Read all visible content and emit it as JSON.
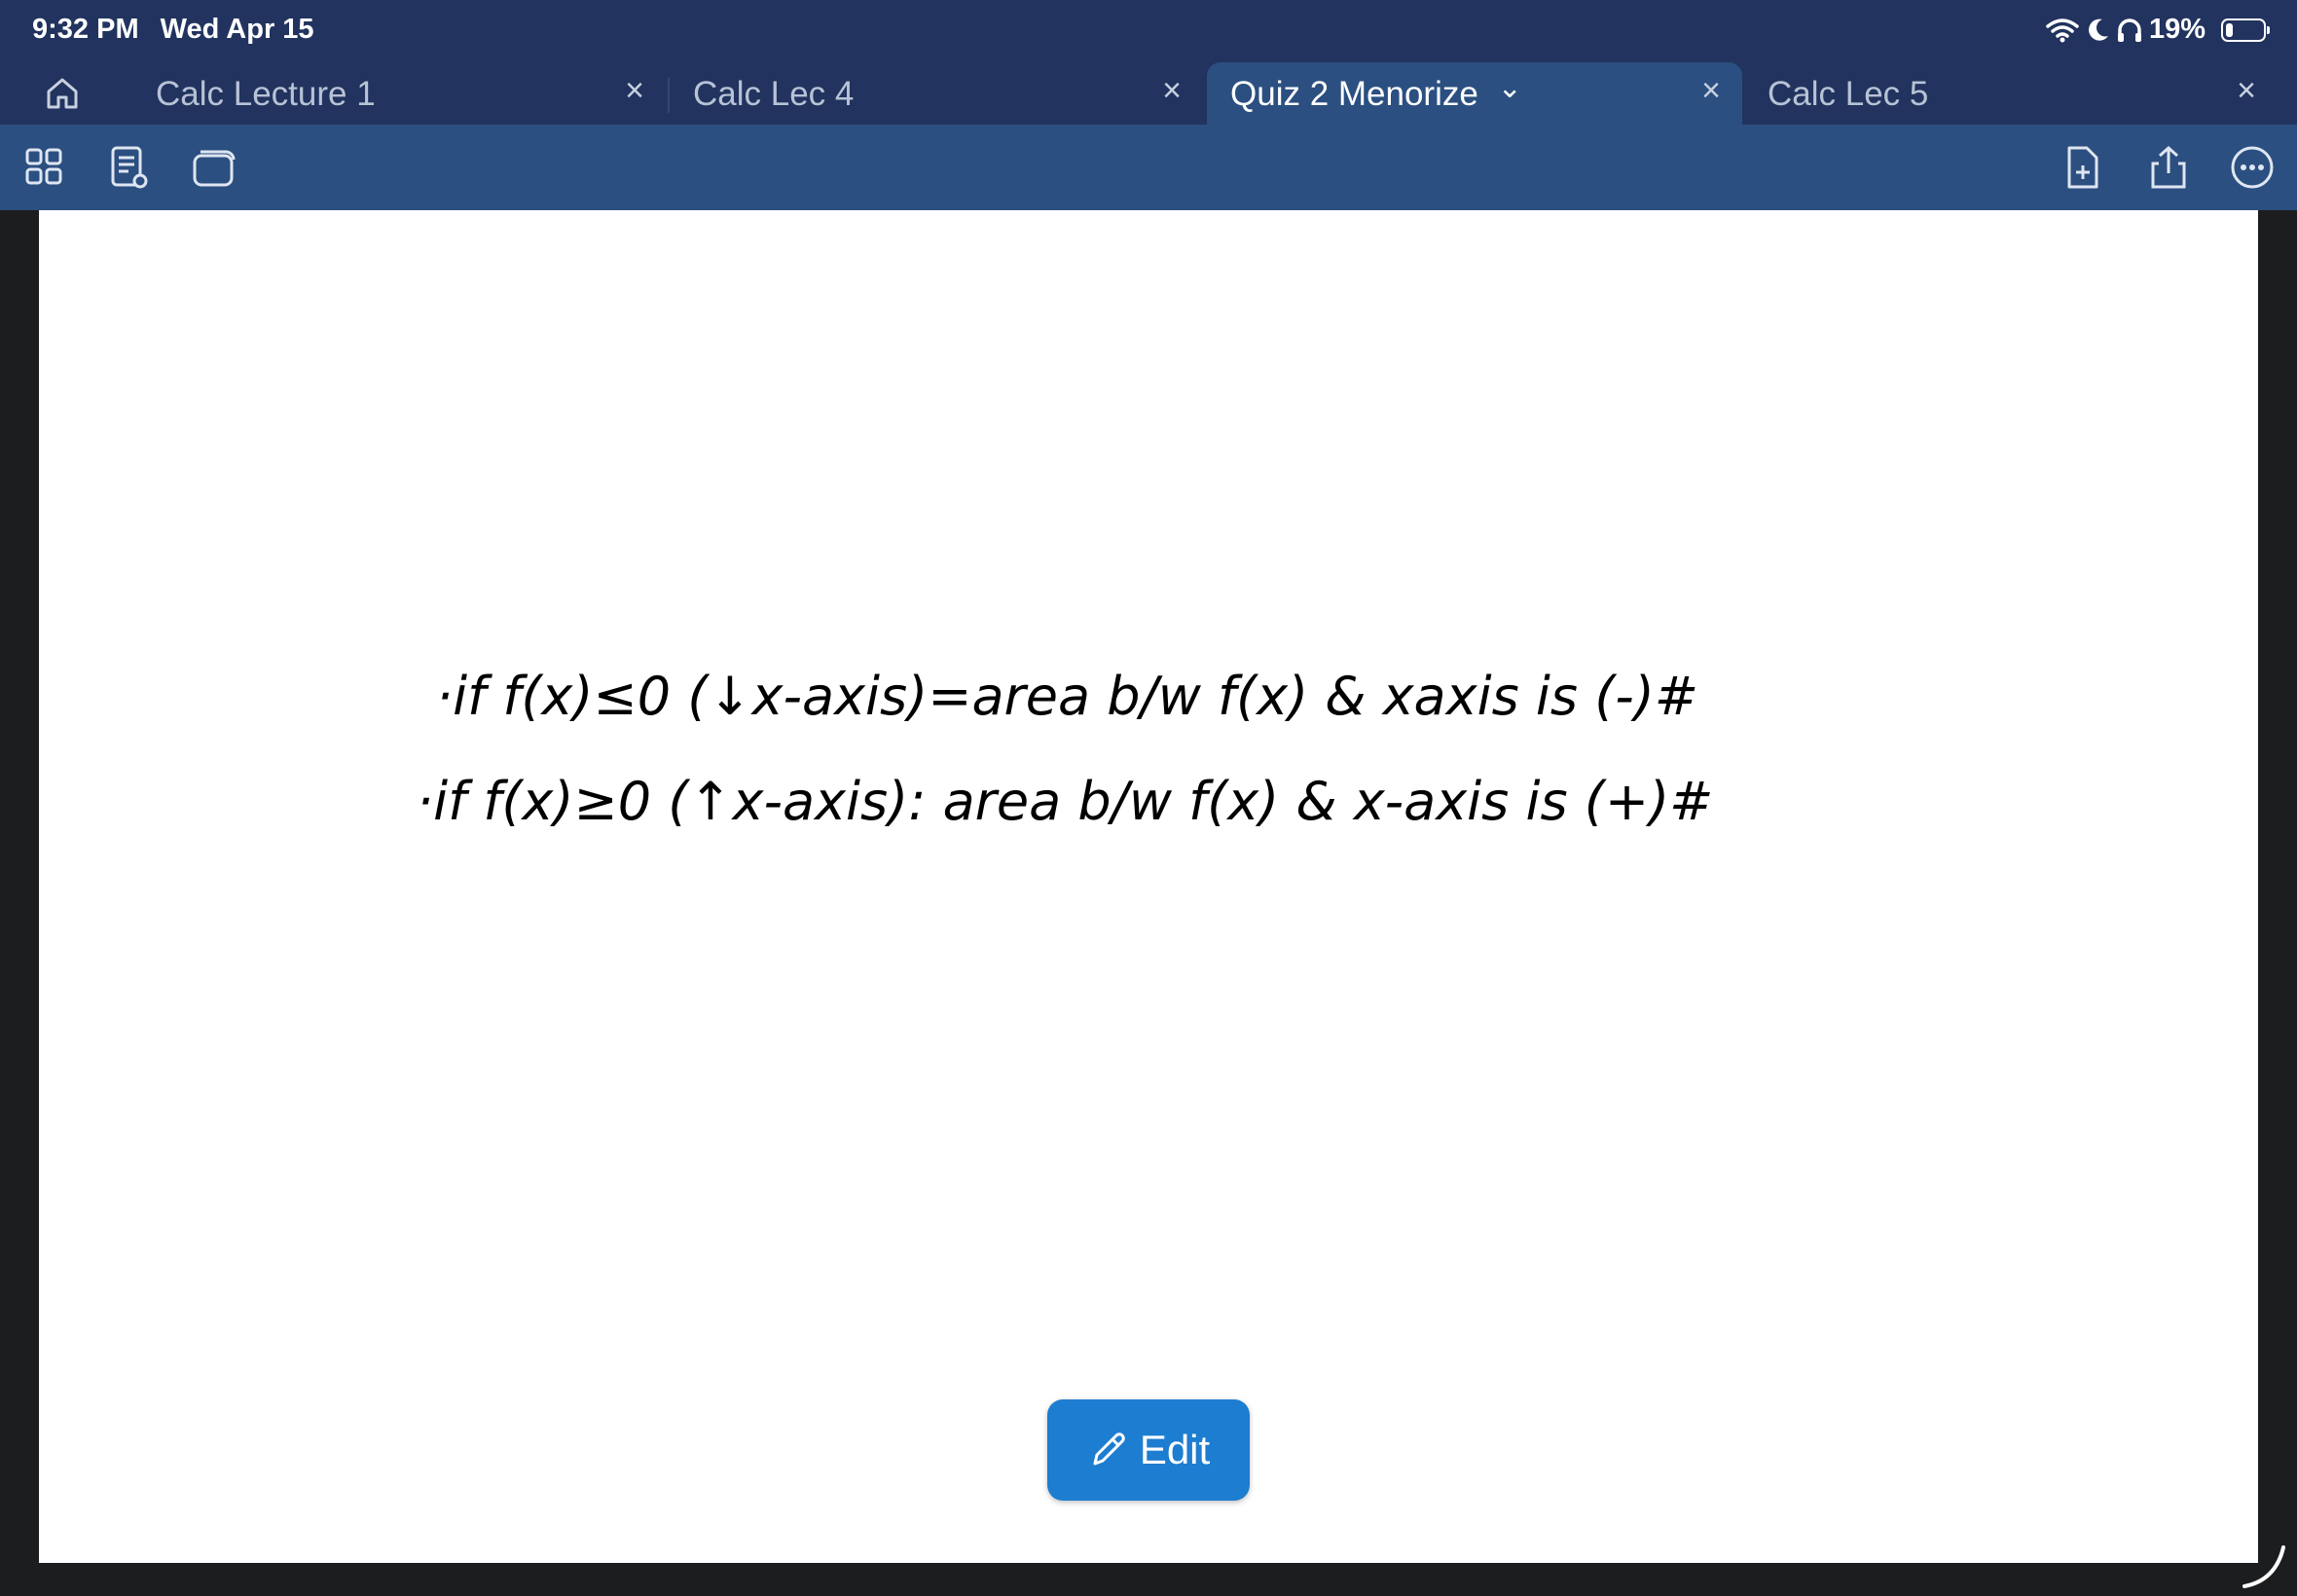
{
  "status_bar": {
    "time": "9:32 PM",
    "date": "Wed Apr 15",
    "battery": "19%",
    "battery_level": 0.19
  },
  "tabs": [
    {
      "label": "Calc Lecture 1",
      "active": false
    },
    {
      "label": "Calc Lec 4",
      "active": false
    },
    {
      "label": "Quiz 2 Menorize",
      "active": true
    },
    {
      "label": "Calc Lec 5",
      "active": false
    }
  ],
  "tab_close_glyph": "×",
  "active_tab_chevron": "⌄",
  "note": {
    "lines": [
      "·if f(x)≤0 (↓x-axis)=area b/w f(x) & xaxis is (-)#",
      "·if f(x)≥0 (↑x-axis): area b/w f(x) & x-axis is (+)#"
    ]
  },
  "edit_button": {
    "label": "Edit"
  },
  "icons": {
    "home": "home-icon",
    "grid": "grid-view-icon",
    "reader": "reader-mode-icon",
    "windows": "windows-icon",
    "add_page": "add-page-icon",
    "share": "share-icon",
    "more": "more-icon",
    "pencil": "pencil-icon"
  },
  "colors": {
    "status_bg": "#21335e",
    "toolbar_bg": "#2b4f80",
    "edit_button": "#1d7dd0",
    "page_bg": "#ffffff"
  }
}
